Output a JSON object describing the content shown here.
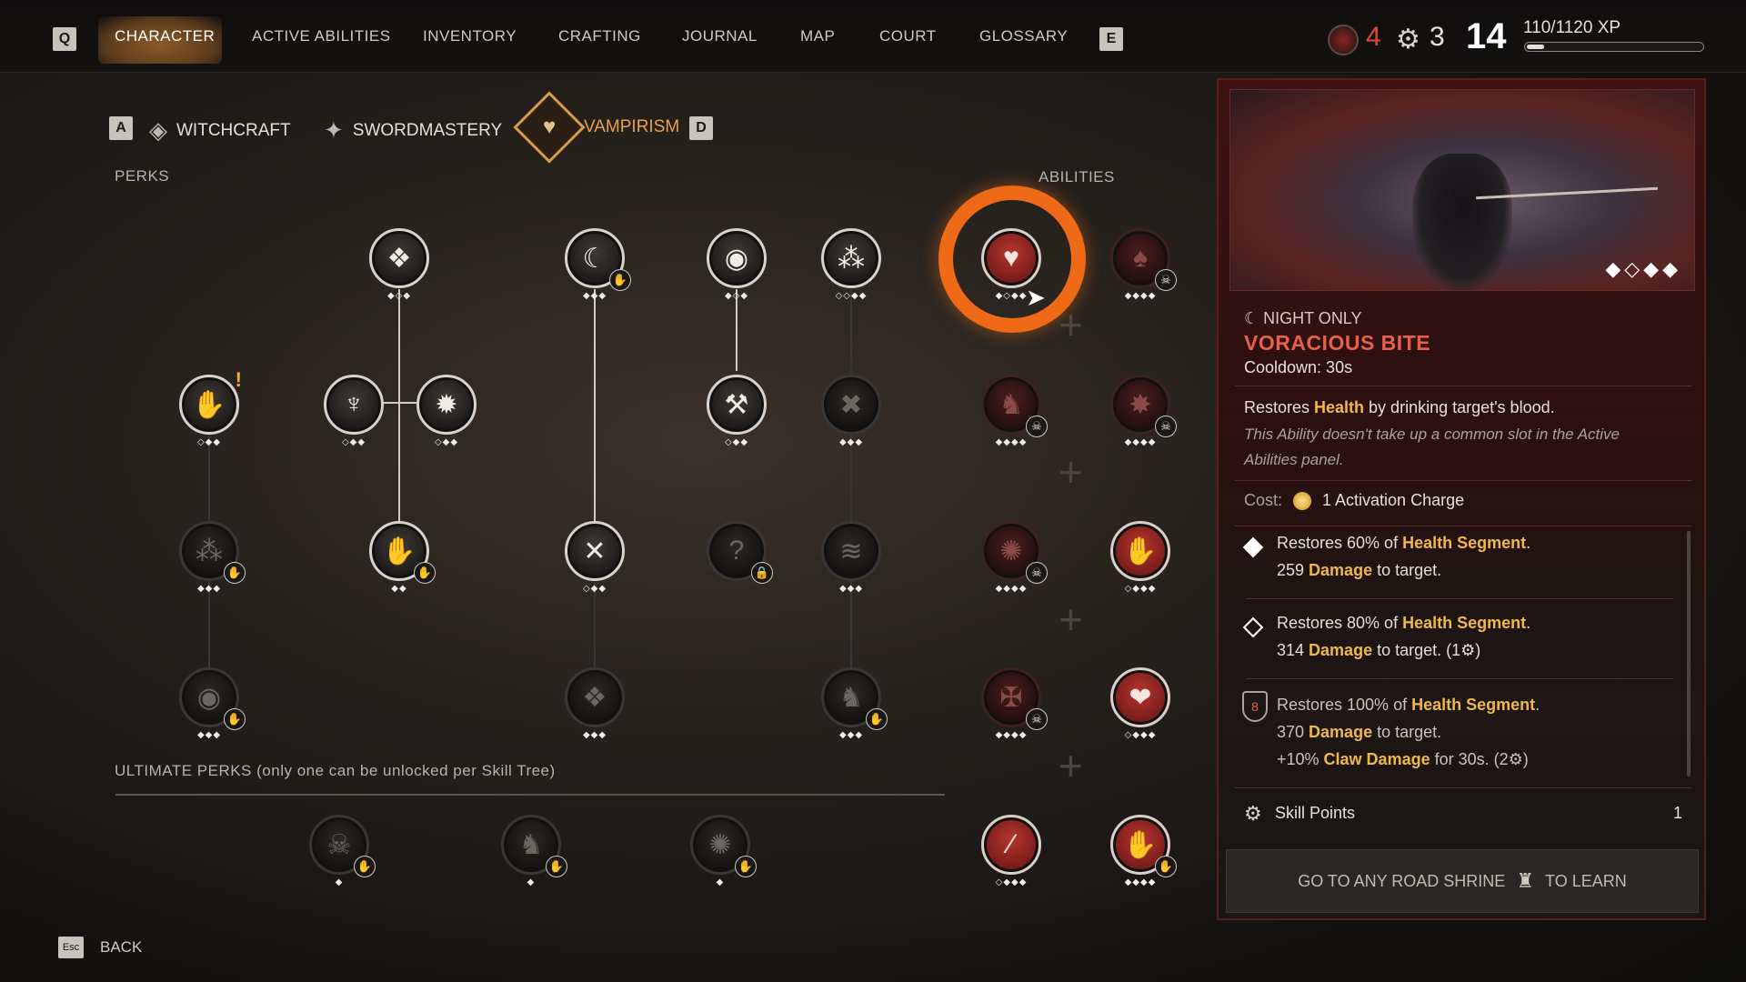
{
  "top_nav": {
    "left_key": "Q",
    "right_key": "E",
    "tabs": [
      "CHARACTER",
      "ACTIVE ABILITIES",
      "INVENTORY",
      "CRAFTING",
      "JOURNAL",
      "MAP",
      "COURT",
      "GLOSSARY"
    ],
    "active_tab": "CHARACTER"
  },
  "stats": {
    "tokens": "4",
    "skill_points": "3",
    "level": "14",
    "xp_text": "110/1120 XP",
    "xp_fraction": 0.098
  },
  "skill_trees": {
    "left_key": "A",
    "right_key": "D",
    "trees": [
      "WITCHCRAFT",
      "SWORDMASTERY",
      "VAMPIRISM"
    ],
    "active": "VAMPIRISM"
  },
  "labels": {
    "perks": "PERKS",
    "abilities": "ABILITIES",
    "ultimate": "ULTIMATE PERKS (only one can be unlocked per Skill Tree)"
  },
  "detail": {
    "time_tag": "NIGHT ONLY",
    "title": "VORACIOUS BITE",
    "cooldown": "Cooldown: 30s",
    "desc_prefix": "Restores ",
    "desc_keyword": "Health",
    "desc_suffix": " by drinking target's blood.",
    "note_line1": "This Ability doesn't take up a common slot in the Active",
    "note_line2": "Abilities panel.",
    "cost_label": "Cost:",
    "cost_value": "1 Activation Charge",
    "ranks": [
      {
        "l1a": "Restores 60% of ",
        "l1b": "Health Segment",
        "l1c": ".",
        "l2a": "259 ",
        "l2b": "Damage",
        "l2c": " to target."
      },
      {
        "l1a": "Restores 80% of ",
        "l1b": "Health Segment",
        "l1c": ".",
        "l2a": "314 ",
        "l2b": "Damage",
        "l2c": " to target.  (1",
        "l2d": ")"
      },
      {
        "l1a": "Restores 100% of ",
        "l1b": "Health Segment",
        "l1c": ".",
        "l2a": "370 ",
        "l2b": "Damage",
        "l2c": " to target.",
        "l3a": "+10% ",
        "l3b": "Claw Damage",
        "l3c": " for 30s.  (2",
        "l3d": ")"
      }
    ],
    "rank3_badge": "8",
    "skill_points_label": "Skill Points",
    "skill_points_value": "1",
    "learn_prefix": "GO TO ANY ROAD SHRINE",
    "learn_suffix": "TO LEARN"
  },
  "back": {
    "key": "Esc",
    "label": "BACK"
  },
  "colors": {
    "accent_orange": "#ee6a16",
    "highlight_gold": "#f0b84a",
    "title_red": "#e8604a"
  }
}
